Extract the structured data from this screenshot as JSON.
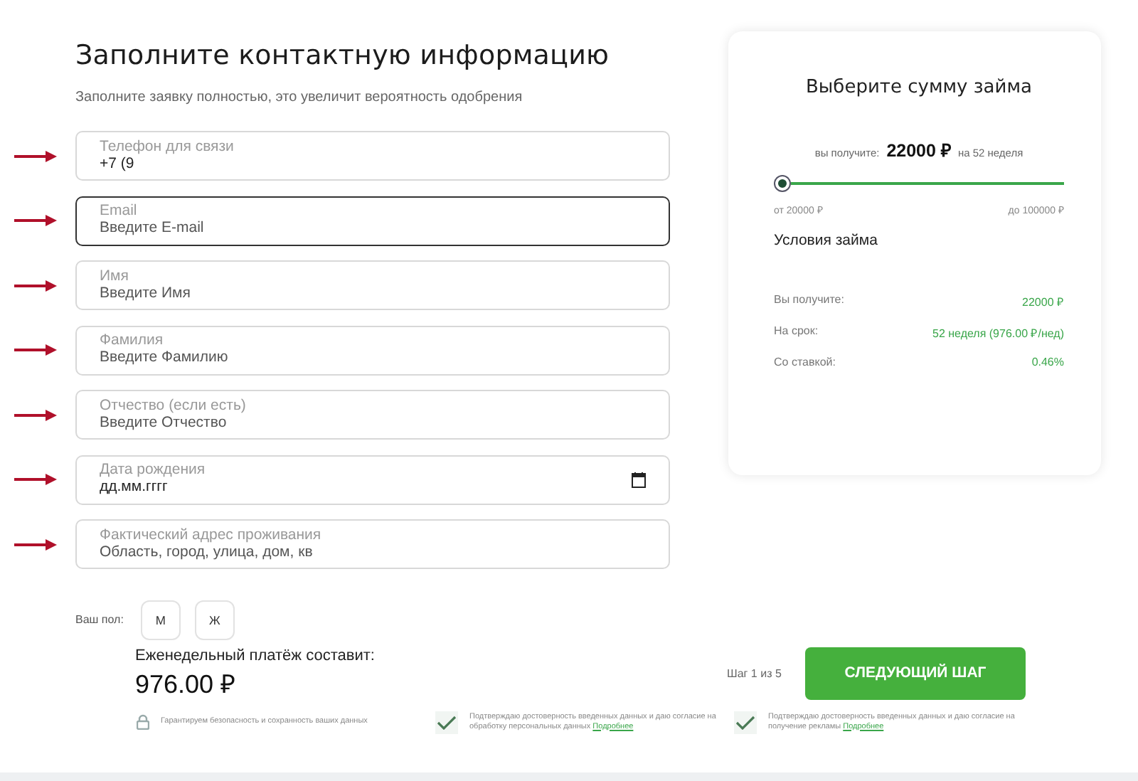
{
  "heading": "Заполните контактную информацию",
  "subheading": "Заполните заявку полностью, это увеличит вероятность одобрения",
  "fields": [
    {
      "kind": "text",
      "label": "Телефон для связи",
      "value": "+7 (9",
      "focused": false,
      "marked": true
    },
    {
      "kind": "text",
      "label": "Email",
      "placeholder": "Введите E-mail",
      "focused": true,
      "marked": true
    },
    {
      "kind": "text",
      "label": "Имя",
      "placeholder": "Введите Имя",
      "focused": false,
      "marked": true
    },
    {
      "kind": "text",
      "label": "Фамилия",
      "placeholder": "Введите Фамилию",
      "focused": false,
      "marked": true
    },
    {
      "kind": "text",
      "label": "Отчество (если есть)",
      "placeholder": "Введите Отчество",
      "focused": false,
      "marked": true
    },
    {
      "kind": "date",
      "label": "Дата рождения",
      "value": "дд.мм.гггг",
      "focused": false,
      "marked": true
    },
    {
      "kind": "text",
      "label": "Фактический адрес проживания",
      "placeholder": "Область, город, улица, дом, кв",
      "focused": false,
      "marked": true
    }
  ],
  "gender": {
    "label": "Ваш пол:",
    "options": [
      {
        "label": "М",
        "selected": false
      },
      {
        "label": "Ж",
        "selected": false
      }
    ]
  },
  "payment": {
    "label": "Еженедельный платёж составит:",
    "amount": "976.00 ₽"
  },
  "step": "Шаг 1 из 5",
  "next_button": "СЛЕДУЮЩИЙ ШАГ",
  "notes": [
    {
      "kind": "lock",
      "text": "Гарантируем безопасность и сохранность ваших данных"
    },
    {
      "kind": "check",
      "checked": true,
      "text": "Подтверждаю достоверность введенных данных и даю согласие на обработку персональных данных",
      "link": "Подробнее"
    },
    {
      "kind": "check",
      "checked": true,
      "text": "Подтверждаю достоверность введенных данных и даю согласие на получение рекламы",
      "link": "Подробнее"
    }
  ],
  "loan_card": {
    "title": "Выберите сумму займа",
    "receive_prefix": "вы получите:",
    "receive_amount": "22000 ₽",
    "receive_suffix": "на 52 неделя",
    "slider": {
      "level": 0,
      "min_label": "от 20000 ₽",
      "max_label": "до 100000 ₽"
    },
    "conditions_title": "Условия займа",
    "conditions": [
      {
        "label": "Вы получите:",
        "value": "22000 ₽"
      },
      {
        "label": "На срок:",
        "value": "52 неделя (976.00 ₽/нед)"
      },
      {
        "label": "Со ставкой:",
        "value": "0.46%"
      }
    ]
  }
}
